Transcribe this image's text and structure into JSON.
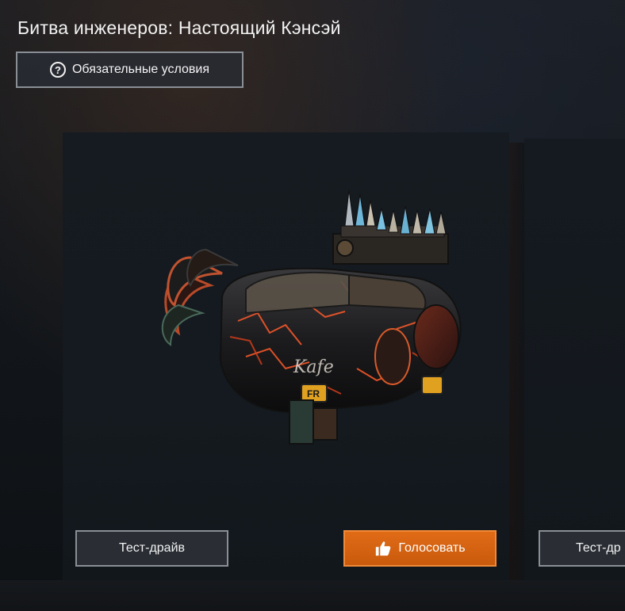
{
  "page": {
    "title": "Битва инженеров: Настоящий Кэнсэй"
  },
  "requirements_button": {
    "label": "Обязательные условия",
    "icon": "question-circle-icon"
  },
  "cards": [
    {
      "image": "armored-vehicle-render",
      "test_drive_label": "Тест-драйв",
      "vote_label": "Голосовать",
      "vote_icon": "thumbs-up-icon"
    },
    {
      "test_drive_label": "Тест-др"
    }
  ],
  "colors": {
    "vote_accent": "#d9640f",
    "button_border": "#8a8f96",
    "background": "#13171c"
  }
}
